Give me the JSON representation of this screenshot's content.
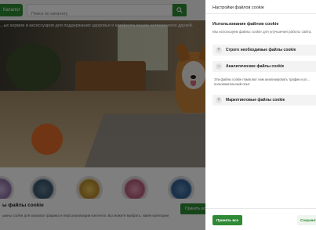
{
  "site": {
    "header": {
      "catalog_label": "Каталог",
      "search_placeholder": "Поиск по каталогу"
    },
    "hero": {
      "text": "...ых кормов и аксессуаров для поддержания здоровья и комфорта ваших четвероногих друзей."
    },
    "cookie_banner": {
      "title": "ы файлы cookie",
      "text": "ыжны cookie для анализа трафика и персонализации контента. Вы можете выбрать, какие категории",
      "button_label": "Принять все"
    }
  },
  "drawer": {
    "title": "Настройки файлов cookie",
    "section_title": "Использование файлов cookie",
    "section_subtitle": "Мы используем файлы cookie для улучшения работы сайта.",
    "accordion": [
      {
        "label": "Строго необходимые файлы cookie",
        "expanded": false,
        "toggle": "+"
      },
      {
        "label": "Аналитические файлы cookie",
        "expanded": true,
        "toggle": "−"
      },
      {
        "label": "Маркетинговые файлы cookie",
        "expanded": false,
        "toggle": "+"
      }
    ],
    "analytics_description": "Эти файлы cookie помогают нам анализировать трафик и ул... пользовательский опыт.",
    "accept_all_label": "Принять все",
    "save_label": "Сохранить"
  },
  "colors": {
    "brand_green": "#2f8a35",
    "overlay": "rgba(0,0,0,0.5)"
  },
  "icons": [
    "search-icon",
    "plus-icon",
    "minus-icon"
  ]
}
